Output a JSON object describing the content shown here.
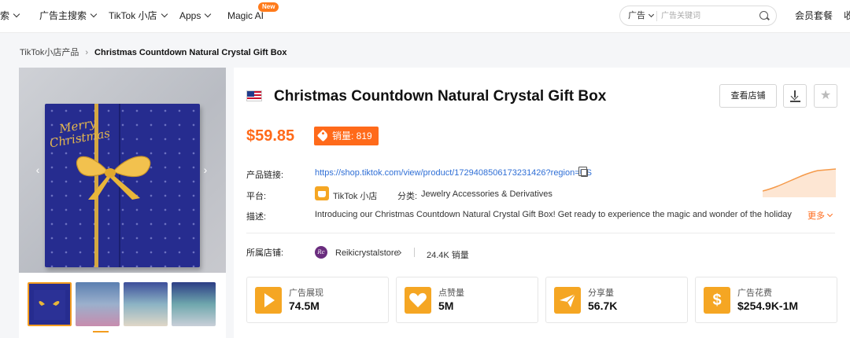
{
  "nav": {
    "items": [
      {
        "label": "搜索"
      },
      {
        "label": "广告主搜索"
      },
      {
        "label": "TikTok 小店"
      },
      {
        "label": "Apps"
      },
      {
        "label": "Magic AI",
        "badge": "New"
      }
    ],
    "search": {
      "type": "广告",
      "placeholder": "广告关键词"
    },
    "member": "会员套餐",
    "more": "收"
  },
  "breadcrumb": {
    "parent": "TikTok小店产品",
    "current": "Christmas Countdown Natural Crystal Gift Box"
  },
  "gallery": {
    "main_image_text": "Merry Christmas",
    "prev_icon": "chevron-left-icon",
    "next_icon": "chevron-right-icon",
    "thumbnails": 4,
    "active_thumbnail": 1
  },
  "product": {
    "flag_icon": "us-flag-icon",
    "title": "Christmas Countdown Natural Crystal Gift Box",
    "shop_button": "查看店铺",
    "price": "$59.85",
    "sales_label": "销量: 819",
    "link_label": "产品链接:",
    "link": "https://shop.tiktok.com/view/product/1729408506173231426?region=US",
    "platform_label": "平台:",
    "platform": "TikTok 小店",
    "category_label": "分类:",
    "category": "Jewelry Accessories & Derivatives",
    "desc_label": "描述:",
    "description": "Introducing our Christmas Countdown Natural Crystal Gift Box! Get ready to experience the magic and wonder of the holiday season...",
    "more_label": "更多",
    "store_label": "所属店铺:",
    "store_name": "Reikicrystalstore",
    "store_avatar": "Rc",
    "store_sales": "24.4K 销量"
  },
  "stats": [
    {
      "label": "广告展现",
      "value": "74.5M",
      "icon": "play-icon"
    },
    {
      "label": "点赞量",
      "value": "5M",
      "icon": "heart-icon"
    },
    {
      "label": "分享量",
      "value": "56.7K",
      "icon": "share-icon"
    },
    {
      "label": "广告花费",
      "value": "$254.9K-1M",
      "icon": "dollar-icon"
    }
  ],
  "colors": {
    "accent": "#ff6a1a",
    "icon_bg": "#f5a623",
    "link": "#2f6fd6"
  }
}
